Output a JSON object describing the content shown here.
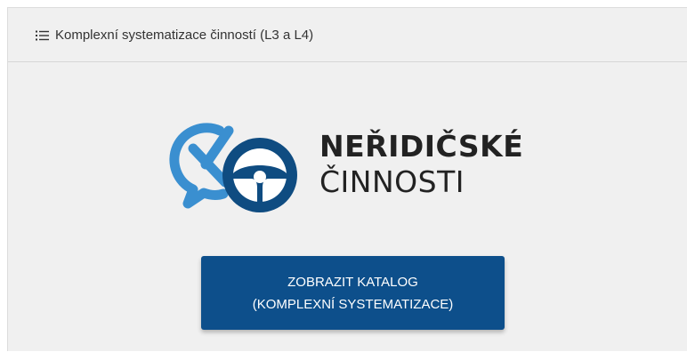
{
  "header": {
    "icon": "list-icon",
    "title": "Komplexní systematizace činností (L3 a L4)"
  },
  "logo": {
    "line1": "NEŘIDIČSKÉ",
    "line2": "ČINNOSTI",
    "colors": {
      "light_blue": "#3a8fd0",
      "dark_blue": "#0f4c81",
      "text": "#222222"
    }
  },
  "catalog_button": {
    "line1": "ZOBRAZIT KATALOG",
    "line2": "(KOMPLEXNÍ SYSTEMATIZACE)",
    "color": "#0d4f8b"
  }
}
